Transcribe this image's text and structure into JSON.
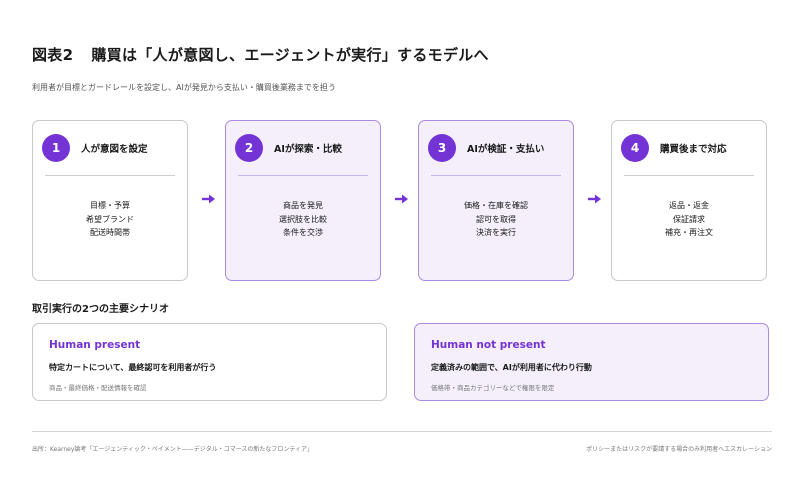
{
  "header": {
    "figure_label": "図表2",
    "title": "購買は「人が意図し、エージェントが実行」するモデルへ",
    "subtitle": "利用者が目標とガードレールを設定し、AIが発見から支払い・購買後業務までを担う"
  },
  "steps": [
    {
      "num": "1",
      "title": "人が意図を設定",
      "items": [
        "目標・予算",
        "希望ブランド",
        "配送時間帯"
      ]
    },
    {
      "num": "2",
      "title": "AIが探索・比較",
      "items": [
        "商品を発見",
        "選択肢を比較",
        "条件を交渉"
      ]
    },
    {
      "num": "3",
      "title": "AIが検証・支払い",
      "items": [
        "価格・在庫を確認",
        "認可を取得",
        "決済を実行"
      ]
    },
    {
      "num": "4",
      "title": "購買後まで対応",
      "items": [
        "返品・返金",
        "保証請求",
        "補充・再注文"
      ]
    }
  ],
  "section_title": "取引実行の2つの主要シナリオ",
  "scenarios": [
    {
      "heading": "Human present",
      "desc": "特定カートについて、最終認可を利用者が行う",
      "note": "商品・最終価格・配送情報を確認"
    },
    {
      "heading": "Human not present",
      "desc": "定義済みの範囲で、AIが利用者に代わり行動",
      "note": "価格帯・商品カテゴリーなどで権限を限定"
    }
  ],
  "footer": {
    "source": "出所：Kearney論考「エージェンティック・ペイメント——デジタル・コマースの新たなフロンティア」",
    "note": "ポリシーまたはリスクが要請する場合のみ利用者へエスカレーション"
  },
  "colors": {
    "accent": "#7433d4",
    "highlight_bg": "#f4effb",
    "highlight_border": "#a98be0"
  }
}
